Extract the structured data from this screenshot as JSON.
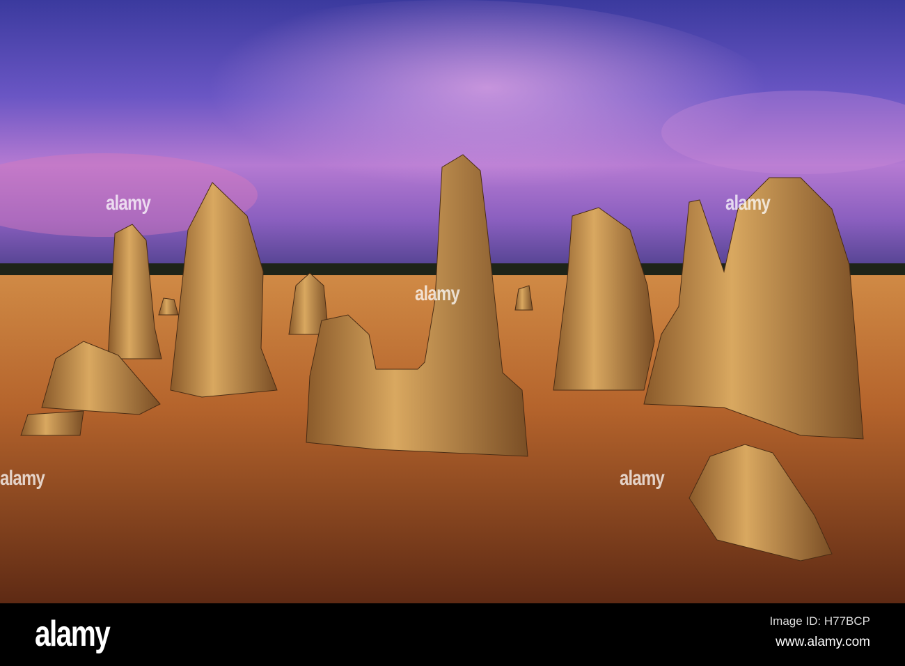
{
  "photo": {
    "subject": "Pinnacles limestone formations under purple sunset sky",
    "watermark_text": "alamy",
    "colors": {
      "sky_top": "#3a3ca0",
      "sky_pink": "#c07ad0",
      "sand": "#b8662e",
      "rock": "#c9954f"
    }
  },
  "footer": {
    "logo": "alamy",
    "image_id": "Image ID: H77BCP",
    "url": "www.alamy.com"
  }
}
